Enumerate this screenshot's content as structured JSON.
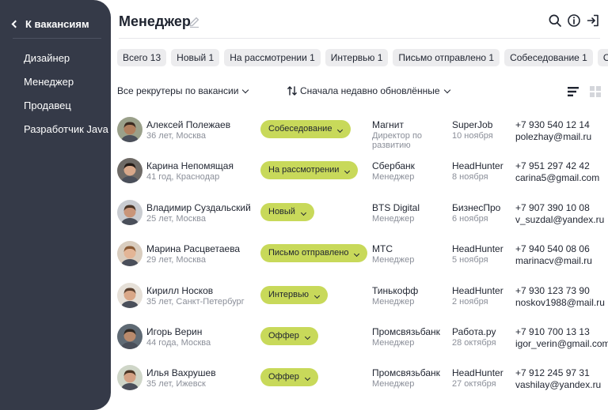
{
  "sidebar": {
    "back_label": "К вакансиям",
    "items": [
      "Дизайнер",
      "Менеджер",
      "Продавец",
      "Разработчик Java"
    ]
  },
  "header": {
    "title": "Менеджер"
  },
  "chips": [
    "Всего 13",
    "Новый 1",
    "На рассмотрении 1",
    "Интервью 1",
    "Письмо отправлено 1",
    "Собеседование 1",
    "Оффе"
  ],
  "filters": {
    "recruiter_label": "Все рекрутеры по вакансии",
    "sort_label": "Сначала недавно обновлённые"
  },
  "candidates": [
    {
      "name": "Алексей Полежаев",
      "meta": "36 лет, Москва",
      "status": "Собеседование",
      "company": "Магнит",
      "role": "Директор по развитию",
      "source": "SuperJob",
      "date": "10 ноября",
      "phone": "+7 930 540 12 14",
      "email": "polezhay@mail.ru",
      "skin": "#b07f5e",
      "hair": "#3b2a20",
      "bg": "#9aa08a"
    },
    {
      "name": "Карина Непомящая",
      "meta": "41 год, Краснодар",
      "status": "На рассмотрении",
      "company": "Сбербанк",
      "role": "Менеджер",
      "source": "HeadHunter",
      "date": "8 ноября",
      "phone": "+7 951 297 42 42",
      "email": "carina5@gmail.com",
      "skin": "#d8a88a",
      "hair": "#241a15",
      "bg": "#6e6a66"
    },
    {
      "name": "Владимир Суздальский",
      "meta": "25 лет, Москва",
      "status": "Новый",
      "company": "BTS Digital",
      "role": "Менеджер",
      "source": "БизнесПро",
      "date": "6 ноября",
      "phone": "+7 907 390 10 08",
      "email": "v_suzdal@yandex.ru",
      "skin": "#c99579",
      "hair": "#4a3526",
      "bg": "#c9ccd1"
    },
    {
      "name": "Марина Расцветаева",
      "meta": "29 лет, Москва",
      "status": "Письмо отправлено",
      "company": "МТС",
      "role": "Менеджер",
      "source": "HeadHunter",
      "date": "5 ноября",
      "phone": "+7 940 540 08 06",
      "email": "marinacv@mail.ru",
      "skin": "#e3b596",
      "hair": "#8a5a35",
      "bg": "#d9cdbf"
    },
    {
      "name": "Кирилл Носков",
      "meta": "35 лет, Санкт-Петербург",
      "status": "Интервью",
      "company": "Тинькофф",
      "role": "Менеджер",
      "source": "HeadHunter",
      "date": "2 ноября",
      "phone": "+7 930 123 73 90",
      "email": "noskov1988@mail.ru",
      "skin": "#d9a788",
      "hair": "#5b4130",
      "bg": "#e6e0d8"
    },
    {
      "name": "Игорь Верин",
      "meta": "44 года, Москва",
      "status": "Оффер",
      "company": "Промсвязьбанк",
      "role": "Менеджер",
      "source": "Работа.ру",
      "date": "28 октября",
      "phone": "+7 910 700 13 13",
      "email": "igor_verin@gmail.com",
      "skin": "#b98a6c",
      "hair": "#2e2722",
      "bg": "#5f6a74"
    },
    {
      "name": "Илья Вахрушев",
      "meta": "35 лет, Ижевск",
      "status": "Оффер",
      "company": "Промсвязьбанк",
      "role": "Менеджер",
      "source": "HeadHunter",
      "date": "27 октября",
      "phone": "+7 912 245 97 31",
      "email": "vashilay@yandex.ru",
      "skin": "#d3a184",
      "hair": "#4b3626",
      "bg": "#cfd6c8"
    }
  ],
  "colors": {
    "sidebar_bg": "#353a48",
    "status_pill": "#c8d95a",
    "chip_bg": "#ececee",
    "muted_text": "#8b8f99"
  },
  "icons": {
    "back": "chevron-left-icon",
    "edit": "pencil-icon",
    "search": "search-icon",
    "info": "info-icon",
    "logout": "logout-icon",
    "sort": "sort-arrows-icon",
    "list_view": "list-view-icon",
    "grid_view": "grid-view-icon"
  }
}
